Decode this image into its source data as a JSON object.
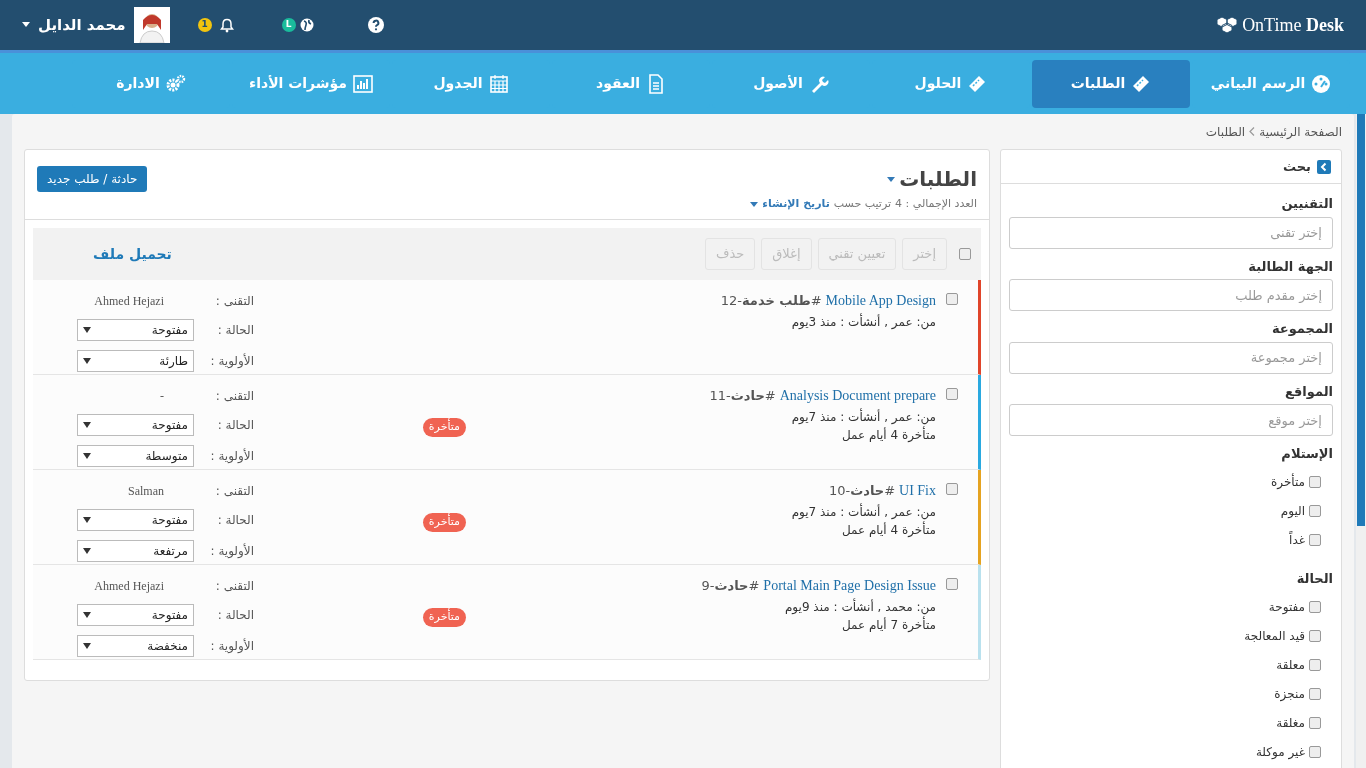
{
  "header": {
    "logo": {
      "light": "OnTime",
      "bold": "Desk"
    },
    "user": {
      "name": "محمد الدايل"
    },
    "notifications": {
      "count": "1"
    },
    "language": {
      "badge": "L"
    }
  },
  "nav": [
    {
      "label": "الرسم البياني",
      "selected": false
    },
    {
      "label": "الطلبات",
      "selected": true
    },
    {
      "label": "الحلول",
      "selected": false
    },
    {
      "label": "الأصول",
      "selected": false
    },
    {
      "label": "العقود",
      "selected": false
    },
    {
      "label": "الجدول",
      "selected": false
    },
    {
      "label": "مؤشرات الأداء",
      "selected": false
    },
    {
      "label": "الادارة",
      "selected": false
    }
  ],
  "breadcrumb": [
    "الصفحة الرئيسية",
    "الطلبات"
  ],
  "sidebar": {
    "title": "بحث",
    "filters": [
      {
        "kind": "field",
        "label": "التقنيين",
        "placeholder": "إختر تقنى"
      },
      {
        "kind": "field",
        "label": "الجهة الطالبة",
        "placeholder": "إختر مقدم طلب"
      },
      {
        "kind": "field",
        "label": "المجموعة",
        "placeholder": "إختر مجموعة"
      },
      {
        "kind": "field",
        "label": "المواقع",
        "placeholder": "إختر موقع"
      },
      {
        "kind": "checks",
        "label": "الإستلام",
        "options": [
          {
            "label": "متأخرة",
            "checked": false
          },
          {
            "label": "اليوم",
            "checked": false
          },
          {
            "label": "غداً",
            "checked": false
          }
        ]
      },
      {
        "kind": "checks",
        "label": "الحالة",
        "options": [
          {
            "label": "مفتوحة",
            "checked": false
          },
          {
            "label": "قيد المعالجة",
            "checked": false
          },
          {
            "label": "معلقة",
            "checked": false
          },
          {
            "label": "منجزة",
            "checked": false
          },
          {
            "label": "مغلقة",
            "checked": false
          },
          {
            "label": "غير موكلة",
            "checked": false
          }
        ]
      }
    ]
  },
  "main": {
    "title": "الطلبات",
    "count": "العدد الإجمالي : 4",
    "sort_label": "ترتيب حسب",
    "sort_value": "تاريخ الإنشاء",
    "new_button": "حادثة / طلب جديد",
    "toolbar": {
      "select_all": false,
      "buttons": [
        {
          "label": "إختر",
          "disabled": true
        },
        {
          "label": "تعيين تقني",
          "disabled": true
        },
        {
          "label": "إغلاق",
          "disabled": true
        },
        {
          "label": "حذف",
          "disabled": true
        }
      ],
      "upload": "تحميل ملف"
    },
    "tickets": [
      {
        "title": "Mobile App Design",
        "ref": "#**طلب خدمة**-12",
        "meta": "من: عمر , أنشأت : منذ 3يوم",
        "labels": {
          "tech": "التقنى :",
          "status": "الحالة :",
          "priority": "الأولوية :"
        },
        "tech": "Ahmed Hejazi",
        "status": "مفتوحة",
        "priority": "طارئة",
        "color": "#e0452b",
        "checked": false
      },
      {
        "title": "Analysis Document prepare",
        "ref": "#**حادث**-11",
        "meta": "من: عمر , أنشأت : منذ 7يوم",
        "late_badge": "متأخرة",
        "late_text": "متأخرة 4 أيام عمل",
        "labels": {
          "tech": "التقنى :",
          "status": "الحالة :",
          "priority": "الأولوية :"
        },
        "tech": "-",
        "status": "مفتوحة",
        "priority": "متوسطة",
        "color": "#2aa9e0",
        "checked": false
      },
      {
        "title": "UI Fix",
        "ref": "#**حادث**-10",
        "meta": "من: عمر , أنشأت : منذ 7يوم",
        "late_badge": "متأخرة",
        "late_text": "متأخرة 4 أيام عمل",
        "labels": {
          "tech": "التقنى :",
          "status": "الحالة :",
          "priority": "الأولوية :"
        },
        "tech": "Salman",
        "status": "مفتوحة",
        "priority": "مرتفعة",
        "color": "#e5a321",
        "checked": false
      },
      {
        "title": "Portal Main Page Design Issue",
        "ref": "#**حادث**-9",
        "meta": "من: محمد , أنشأت : منذ 9يوم",
        "late_badge": "متأخرة",
        "late_text": "متأخرة 7 أيام عمل",
        "labels": {
          "tech": "التقنى :",
          "status": "الحالة :",
          "priority": "الأولوية :"
        },
        "tech": "Ahmed Hejazi",
        "status": "مفتوحة",
        "priority": "منخفضة",
        "color": "#b9e1ee",
        "checked": false
      }
    ]
  }
}
